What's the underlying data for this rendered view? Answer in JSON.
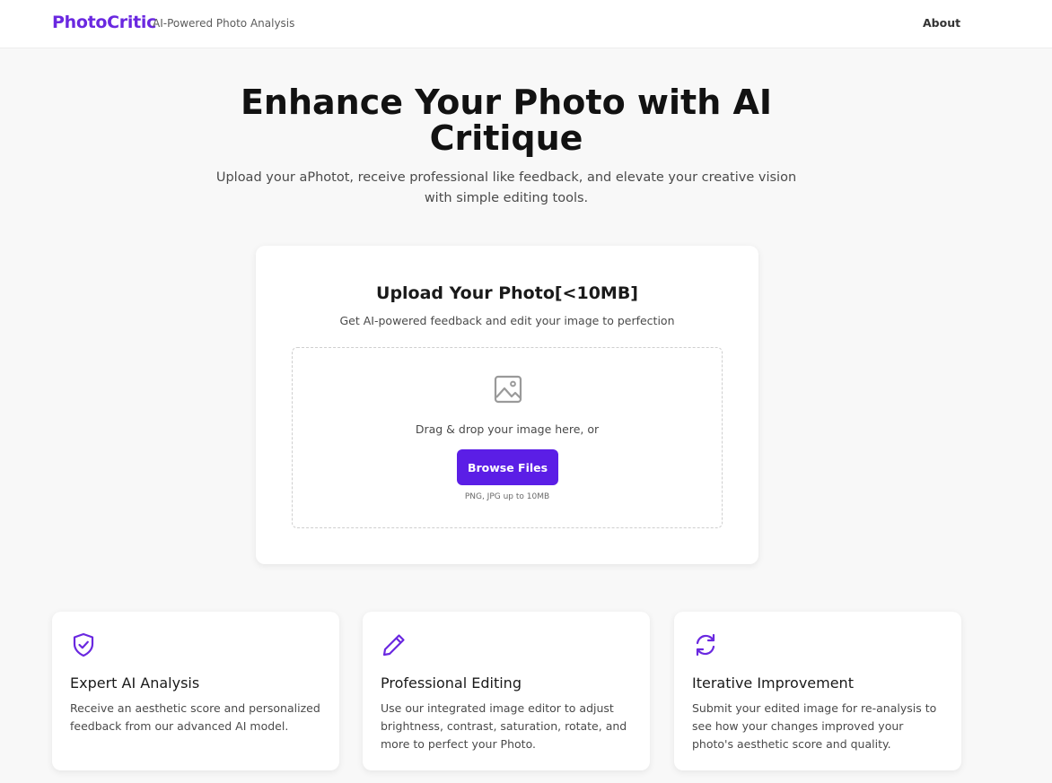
{
  "header": {
    "brand": "PhotoCritic",
    "tagline": "AI-Powered Photo Analysis",
    "nav_about": "About"
  },
  "hero": {
    "title": "Enhance Your Photo with AI Critique",
    "subtitle": "Upload your aPhotot, receive professional like feedback, and elevate your creative vision with simple editing tools."
  },
  "upload": {
    "title": "Upload Your Photo[<10MB]",
    "subtitle": "Get AI-powered feedback and edit your image to perfection",
    "drop_text": "Drag & drop your image here, or",
    "browse_label": "Browse Files",
    "note": "PNG, JPG up to 10MB",
    "icon": "image-icon"
  },
  "features": [
    {
      "icon": "shield-check-icon",
      "title": "Expert AI Analysis",
      "description": "Receive an aesthetic score and personalized feedback from our advanced AI model."
    },
    {
      "icon": "pencil-icon",
      "title": "Professional Editing",
      "description": "Use our integrated image editor to adjust brightness, contrast, saturation, rotate, and more to perfect your Photo."
    },
    {
      "icon": "refresh-icon",
      "title": "Iterative Improvement",
      "description": "Submit your edited image for re-analysis to see how your changes improved your photo's aesthetic score and quality."
    }
  ],
  "colors": {
    "accent": "#5b1ee6",
    "brand": "#6a28e0",
    "background": "#f8f8f8"
  }
}
